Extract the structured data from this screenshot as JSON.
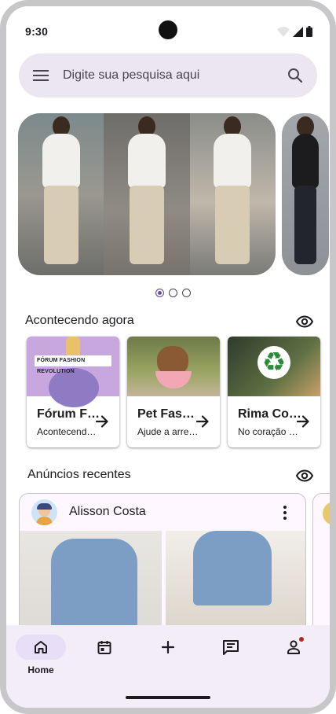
{
  "status_bar": {
    "time": "9:30"
  },
  "search": {
    "placeholder": "Digite sua pesquisa aqui"
  },
  "carousel": {
    "page_count": 3,
    "active_page": 1
  },
  "happening_now": {
    "title": "Acontecendo agora",
    "cards": [
      {
        "title": "Fórum Fashion Revolution",
        "subtitle": "Acontecendo agora",
        "image_text": "FÓRUM FASHION REVOLUTION"
      },
      {
        "title": "Pet Fashion",
        "subtitle": "Ajude a arrecadar"
      },
      {
        "title": "Rima Consciente",
        "subtitle": "No coração da cidade"
      }
    ]
  },
  "recent_ads": {
    "title": "Anúncios recentes",
    "post": {
      "author": "Alisson Costa"
    }
  },
  "bottom_nav": {
    "items": [
      {
        "label": "Home",
        "icon": "home-icon",
        "active": true
      },
      {
        "label": "",
        "icon": "calendar-icon"
      },
      {
        "label": "",
        "icon": "add-icon"
      },
      {
        "label": "",
        "icon": "chat-icon"
      },
      {
        "label": "",
        "icon": "profile-icon"
      }
    ]
  },
  "colors": {
    "surface": "#ffffff",
    "search_bg": "#ece6f0",
    "nav_bg": "#f3edf7",
    "active_pill": "#e8def8",
    "primary": "#6750a4",
    "notification": "#b3261e"
  }
}
